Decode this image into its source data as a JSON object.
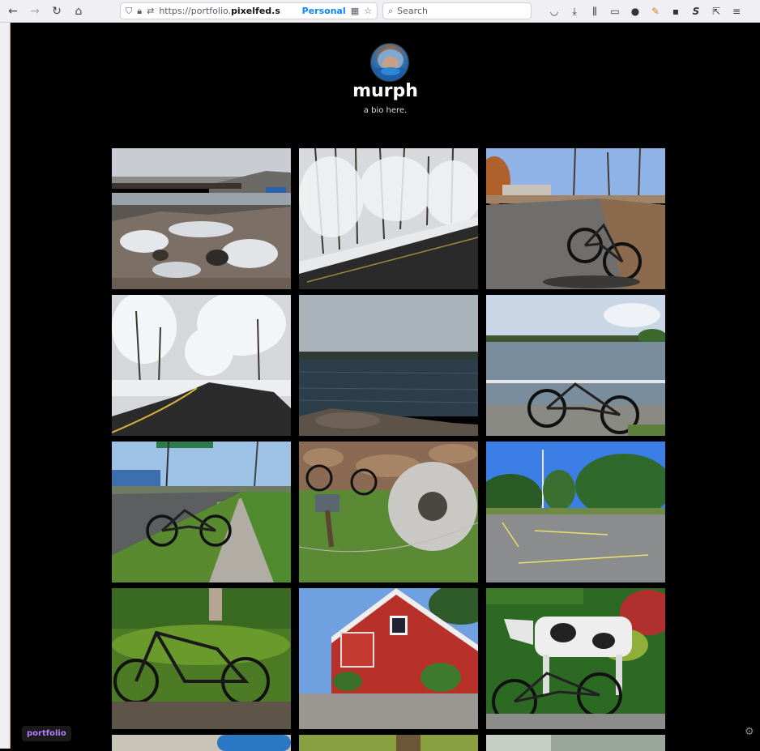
{
  "browser": {
    "url_prefix": "https://portfolio.",
    "url_domain": "pixelfed.s",
    "container_label": "Personal",
    "search_placeholder": "Search"
  },
  "profile": {
    "username": "murph",
    "bio": "a bio here."
  },
  "footer": {
    "badge_label": "portfolio"
  },
  "photos": [
    {
      "alt": "waterfall-bridge"
    },
    {
      "alt": "snowy-road-trees"
    },
    {
      "alt": "bike-on-road-autumn"
    },
    {
      "alt": "snow-curving-road"
    },
    {
      "alt": "lake-rocks"
    },
    {
      "alt": "bike-by-lake"
    },
    {
      "alt": "bike-roadside-sign"
    },
    {
      "alt": "millstone-bike"
    },
    {
      "alt": "parking-lot-flagpole"
    },
    {
      "alt": "bike-on-grass"
    },
    {
      "alt": "red-house"
    },
    {
      "alt": "cow-statue-bike"
    }
  ]
}
